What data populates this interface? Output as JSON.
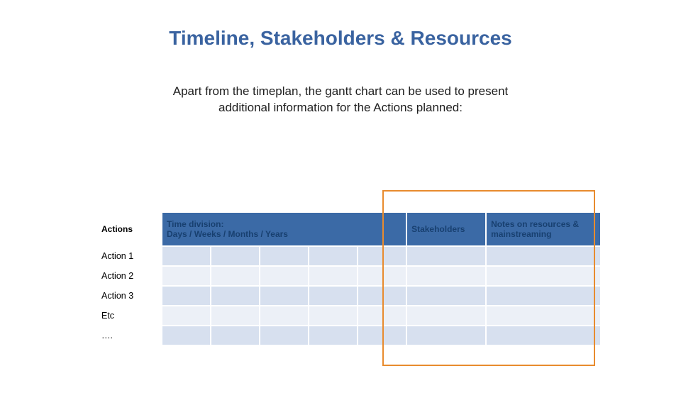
{
  "title": "Timeline, Stakeholders & Resources",
  "subtitle": "Apart from the timeplan, the gantt chart can be used to present\nadditional information for the Actions planned:",
  "headers": {
    "actions": "Actions",
    "time": "Time division:\nDays / Weeks / Months / Years",
    "stakeholders": "Stakeholders",
    "notes": "Notes on resources & mainstreaming"
  },
  "rows": [
    "Action 1",
    "Action 2",
    "Action 3",
    "Etc",
    "…."
  ]
}
